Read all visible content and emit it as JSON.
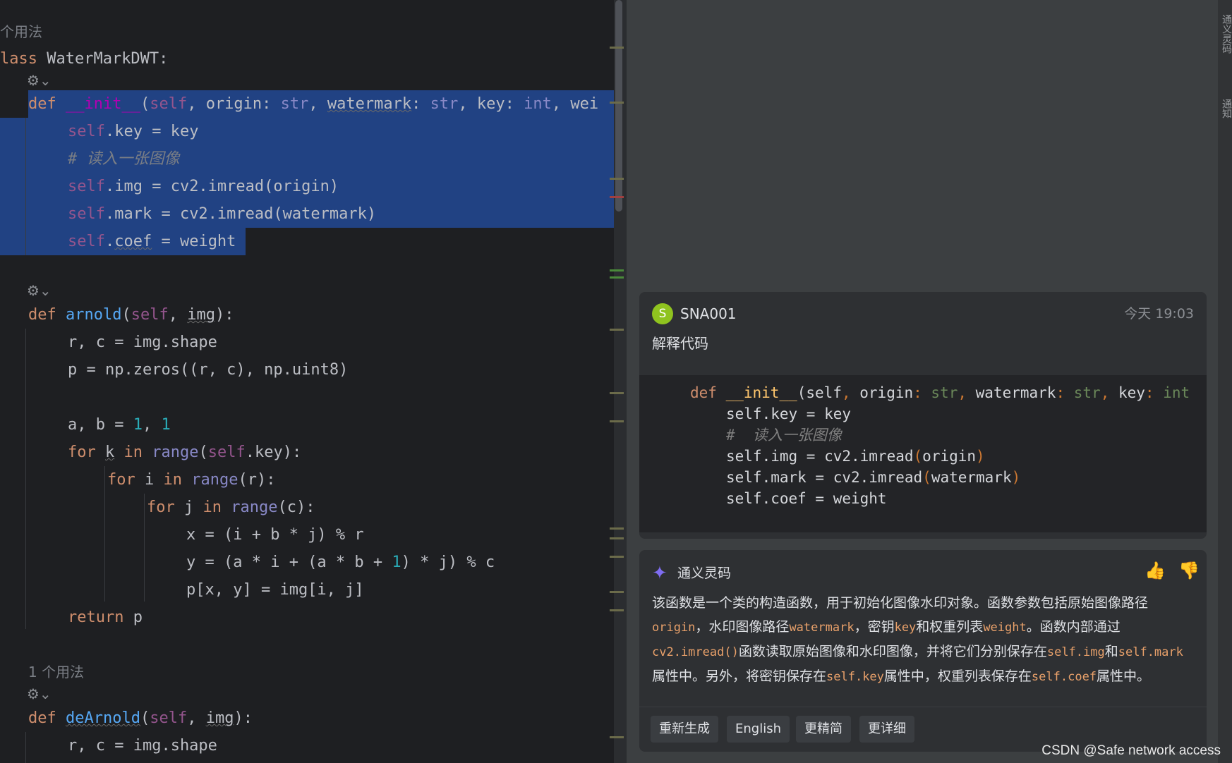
{
  "editor": {
    "usage_hint_top": "个用法",
    "usage_hint_mid": "1 个用法",
    "class_line_kw": "lass",
    "class_name": " WaterMarkDWT:",
    "ai_glyph": "⚙⌄",
    "code": {
      "def": "def",
      "init": "__init__",
      "init_params_a": "(",
      "self": "self",
      "init_params_b": ", origin: ",
      "str": "str",
      "init_params_c": ", ",
      "watermark": "watermark",
      "init_params_d": ": ",
      "init_params_e": ", key: ",
      "int": "int",
      "init_params_f": ", wei",
      "l_key": ".key = key",
      "l_comment": "# 读入一张图像",
      "l_img": ".img = cv2.imread(origin)",
      "l_mark": ".mark = cv2.imread(watermark)",
      "l_coef_a": ".",
      "coef": "coef",
      "l_coef_b": " = weight",
      "arnold": "arnold",
      "img_param": "img",
      "sig_open": "(",
      "sig_comma": ", ",
      "sig_close": "):",
      "rc_line": "r, c = img.shape",
      "p_line": "p = np.zeros((r, c), np.uint8)",
      "ab_line_a": "a, b = ",
      "one": "1",
      "comma": ", ",
      "for": "for",
      "in": "in",
      "range": "range",
      "k": "k",
      "for_k_tail": ".key):",
      "for_i_tail": "(r):",
      "for_j_tail": "(c):",
      "i_var": " i ",
      "j_var": " j ",
      "x_line": "x = (i + b * j) % r",
      "y_line_a": "y = (a * i + (a * b + ",
      "y_line_b": ") * j) % c",
      "p_assign": "p[x, y] = img[i, j]",
      "return": "return",
      "return_tail": " p",
      "dearnold": "deArnold",
      "rc_line2": "r, c = img.shape"
    }
  },
  "chat": {
    "user": {
      "avatar_letter": "S",
      "name": "SNA001",
      "time": "今天 19:03",
      "prompt": "解释代码"
    },
    "snippet": {
      "l1_def": "def",
      "l1_fn": "__init__",
      "l1_a": "(self",
      "l1_p1": ", ",
      "l1_b": "origin",
      "l1_c": ": ",
      "l1_str": "str",
      "l1_d": "watermark",
      "l1_e": "key",
      "l1_int": "int",
      "l2": "self.key = key",
      "l3": "#  读入一张图像",
      "l4_a": "self.img = cv2.imread",
      "l4_b": "(",
      "l4_c": "origin",
      "l4_d": ")",
      "l5_a": "self.mark = cv2.imread",
      "l5_c": "watermark",
      "l6": "self.coef = weight"
    },
    "bot": {
      "name": "通义灵码",
      "thumb_up": "👍",
      "thumb_down": "👎",
      "answer": {
        "t1": "该函数是一个类的构造函数，用于初始化图像水印对象。函数参数包括原始图像路径",
        "c1": "origin",
        "t2": "，水印图像路径",
        "c2": "watermark",
        "t3": "，密钥",
        "c3": "key",
        "t4": "和权重列表",
        "c4": "weight",
        "t5": "。函数内部通过",
        "c5": "cv2.imread()",
        "t6": "函数读取原始图像和水印图像，并将它们分别保存在",
        "c6": "self.img",
        "t7": "和",
        "c7": "self.mark",
        "t8": "属性中。另外，将密钥保存在",
        "c8": "self.key",
        "t9": "属性中，权重列表保存在",
        "c9": "self.coef",
        "t10": "属性中。"
      },
      "actions": [
        "重新生成",
        "English",
        "更精简",
        "更详细"
      ]
    }
  },
  "sidebar": {
    "tab1": "通义灵码",
    "tab2": "通知"
  },
  "watermark": "CSDN @Safe network access"
}
